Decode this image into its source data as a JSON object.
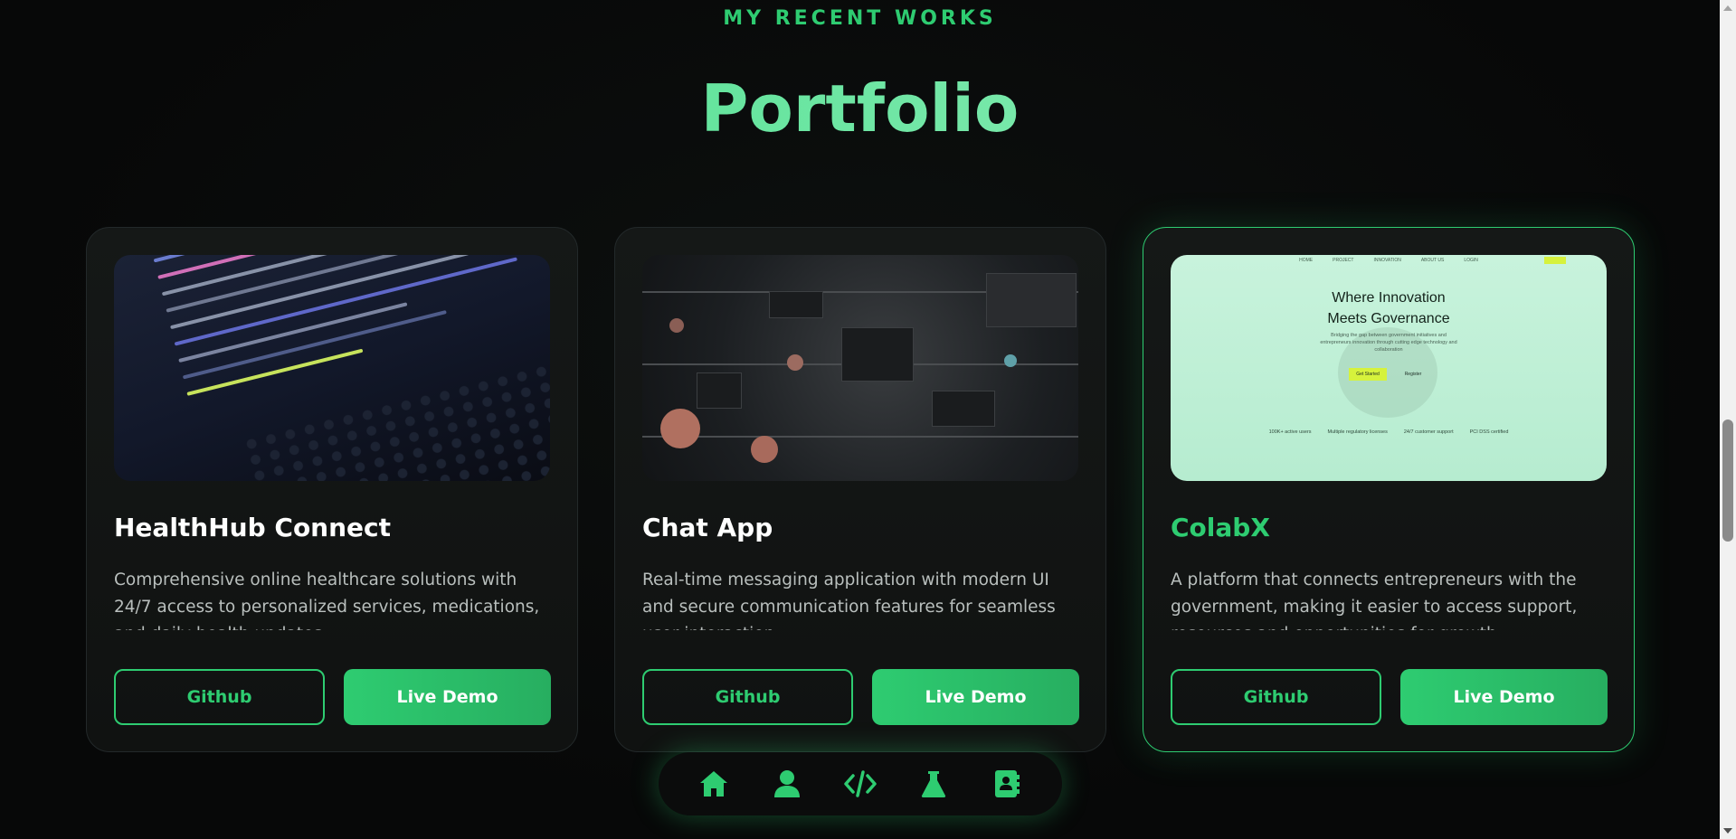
{
  "section": {
    "eyebrow": "MY RECENT WORKS",
    "title": "Portfolio"
  },
  "projects": [
    {
      "title": "HealthHub Connect",
      "description": "Comprehensive online healthcare solutions with 24/7 access to personalized services, medications, and daily health updates.",
      "github_label": "Github",
      "demo_label": "Live Demo",
      "thumbnail": "code-on-laptop-photo"
    },
    {
      "title": "Chat App",
      "description": "Real-time messaging application with modern UI and secure communication features for seamless user interaction.",
      "github_label": "Github",
      "demo_label": "Live Demo",
      "thumbnail": "circuit-board-photo"
    },
    {
      "title": "ColabX",
      "description": "A platform that connects entrepreneurs with the government, making it easier to access support, resources and opportunities for growth.",
      "github_label": "Github",
      "demo_label": "Live Demo",
      "thumbnail": "colabx-website-screenshot",
      "preview": {
        "nav": [
          "HOME",
          "PROJECT",
          "INNOVATION",
          "ABOUT US",
          "LOGIN"
        ],
        "heading_line1": "Where  Innovation",
        "heading_line2": "Meets Governance",
        "subtext": "Bridging the gap between government initiatives and entrepreneurs innovation through cutting edge technology and collaboration",
        "primary_button": "Get Started",
        "secondary_button": "Register",
        "stats": [
          "100K+ active users",
          "Multiple regulatory licenses",
          "24/7 customer support",
          "PCI DSS certified"
        ]
      }
    }
  ],
  "dock": {
    "icons": [
      "home-icon",
      "user-icon",
      "code-icon",
      "flask-icon",
      "contact-book-icon"
    ]
  },
  "colors": {
    "accent": "#2ecc71",
    "background": "#070808",
    "card": "#131615"
  }
}
